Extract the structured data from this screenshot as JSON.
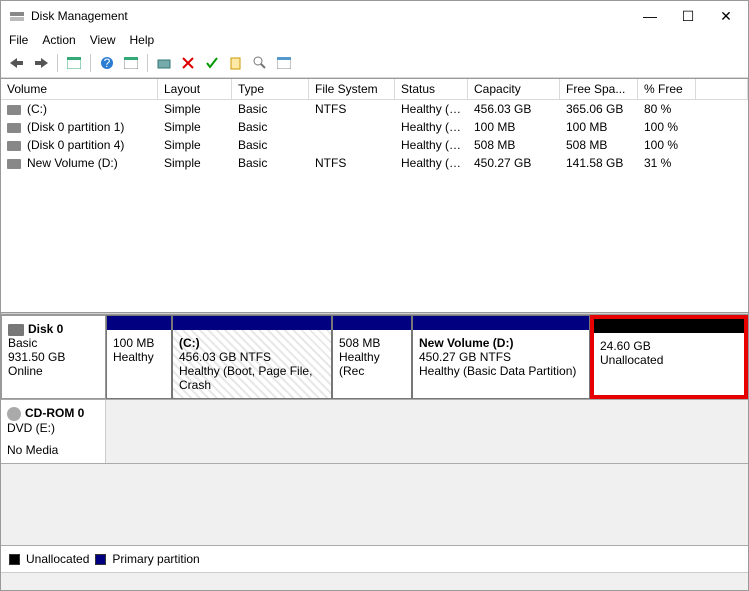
{
  "window": {
    "title": "Disk Management"
  },
  "menu": {
    "file": "File",
    "action": "Action",
    "view": "View",
    "help": "Help"
  },
  "columns": {
    "volume": "Volume",
    "layout": "Layout",
    "type": "Type",
    "fs": "File System",
    "status": "Status",
    "capacity": "Capacity",
    "free": "Free Spa...",
    "pct": "% Free"
  },
  "volumes": [
    {
      "name": "(C:)",
      "layout": "Simple",
      "type": "Basic",
      "fs": "NTFS",
      "status": "Healthy (B...",
      "capacity": "456.03 GB",
      "free": "365.06 GB",
      "pct": "80 %"
    },
    {
      "name": "(Disk 0 partition 1)",
      "layout": "Simple",
      "type": "Basic",
      "fs": "",
      "status": "Healthy (E...",
      "capacity": "100 MB",
      "free": "100 MB",
      "pct": "100 %"
    },
    {
      "name": "(Disk 0 partition 4)",
      "layout": "Simple",
      "type": "Basic",
      "fs": "",
      "status": "Healthy (R...",
      "capacity": "508 MB",
      "free": "508 MB",
      "pct": "100 %"
    },
    {
      "name": "New Volume (D:)",
      "layout": "Simple",
      "type": "Basic",
      "fs": "NTFS",
      "status": "Healthy (B...",
      "capacity": "450.27 GB",
      "free": "141.58 GB",
      "pct": "31 %"
    }
  ],
  "disk0": {
    "name": "Disk 0",
    "type": "Basic",
    "size": "931.50 GB",
    "state": "Online",
    "parts": [
      {
        "label": "",
        "line2": "100 MB",
        "line3": "Healthy"
      },
      {
        "label": "(C:)",
        "line2": "456.03 GB NTFS",
        "line3": "Healthy (Boot, Page File, Crash"
      },
      {
        "label": "",
        "line2": "508 MB",
        "line3": "Healthy (Rec"
      },
      {
        "label": "New Volume  (D:)",
        "line2": "450.27 GB NTFS",
        "line3": "Healthy (Basic Data Partition)"
      },
      {
        "label": "",
        "line2": "24.60 GB",
        "line3": "Unallocated"
      }
    ]
  },
  "cdrom": {
    "name": "CD-ROM 0",
    "drive": "DVD (E:)",
    "state": "No Media"
  },
  "legend": {
    "unalloc": "Unallocated",
    "primary": "Primary partition"
  }
}
